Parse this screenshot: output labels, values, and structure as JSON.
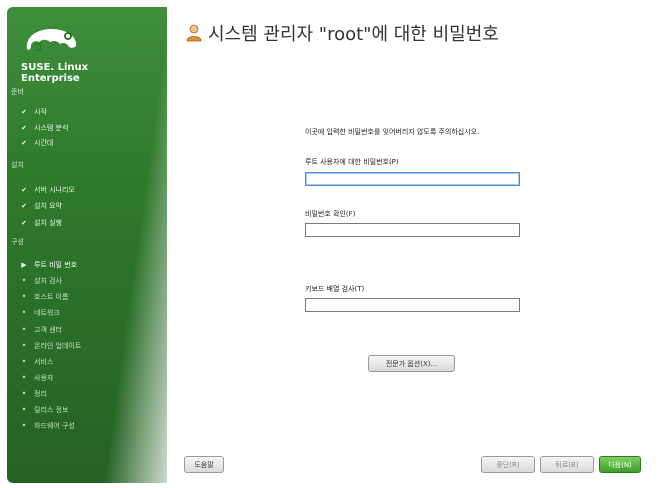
{
  "sidebar": {
    "brand_line1": "SUSE. Linux",
    "brand_line2": "Enterprise",
    "steps": [
      {
        "label": "준비",
        "kind": "section"
      },
      {
        "label": "시작",
        "kind": "done"
      },
      {
        "label": "시스템 분석",
        "kind": "done"
      },
      {
        "label": "시간대",
        "kind": "done"
      },
      {
        "label": "설치",
        "kind": "section"
      },
      {
        "label": "서버 시나리오",
        "kind": "done"
      },
      {
        "label": "설치 요약",
        "kind": "done"
      },
      {
        "label": "설치 실행",
        "kind": "done"
      },
      {
        "label": "구성",
        "kind": "section"
      },
      {
        "label": "루트 비밀 번호",
        "kind": "current"
      },
      {
        "label": "설치 검사",
        "kind": "todo"
      },
      {
        "label": "호스트 이름",
        "kind": "todo"
      },
      {
        "label": "네트워크",
        "kind": "todo"
      },
      {
        "label": "고객 센터",
        "kind": "todo"
      },
      {
        "label": "온라인 업데이트",
        "kind": "todo"
      },
      {
        "label": "서비스",
        "kind": "todo"
      },
      {
        "label": "사용자",
        "kind": "todo"
      },
      {
        "label": "정리",
        "kind": "todo"
      },
      {
        "label": "릴리스 정보",
        "kind": "todo"
      },
      {
        "label": "하드웨어 구성",
        "kind": "todo"
      }
    ]
  },
  "header": {
    "title": "시스템 관리자 \"root\"에 대한 비밀번호",
    "icon": "user-icon"
  },
  "form": {
    "note": "이곳에 입력한 비밀번호를 잊어버리지 않도록 주의하십시오.",
    "password_label": "루트 사용자에 대한 비밀번호(P)",
    "password_value": "",
    "confirm_label": "비밀번호 확인(F)",
    "confirm_value": "",
    "keyboard_label": "키보드 배열 검사(T)",
    "keyboard_value": "",
    "expert_button": "전문가 옵션(X)..."
  },
  "footer": {
    "help": "도움말",
    "abort": "중단(R)",
    "back": "뒤로(B)",
    "next": "다음(N)"
  },
  "colors": {
    "sidebar_green": "#2f7a2c",
    "next_button": "#3e9d27",
    "focus_blue": "#4a90d9"
  }
}
